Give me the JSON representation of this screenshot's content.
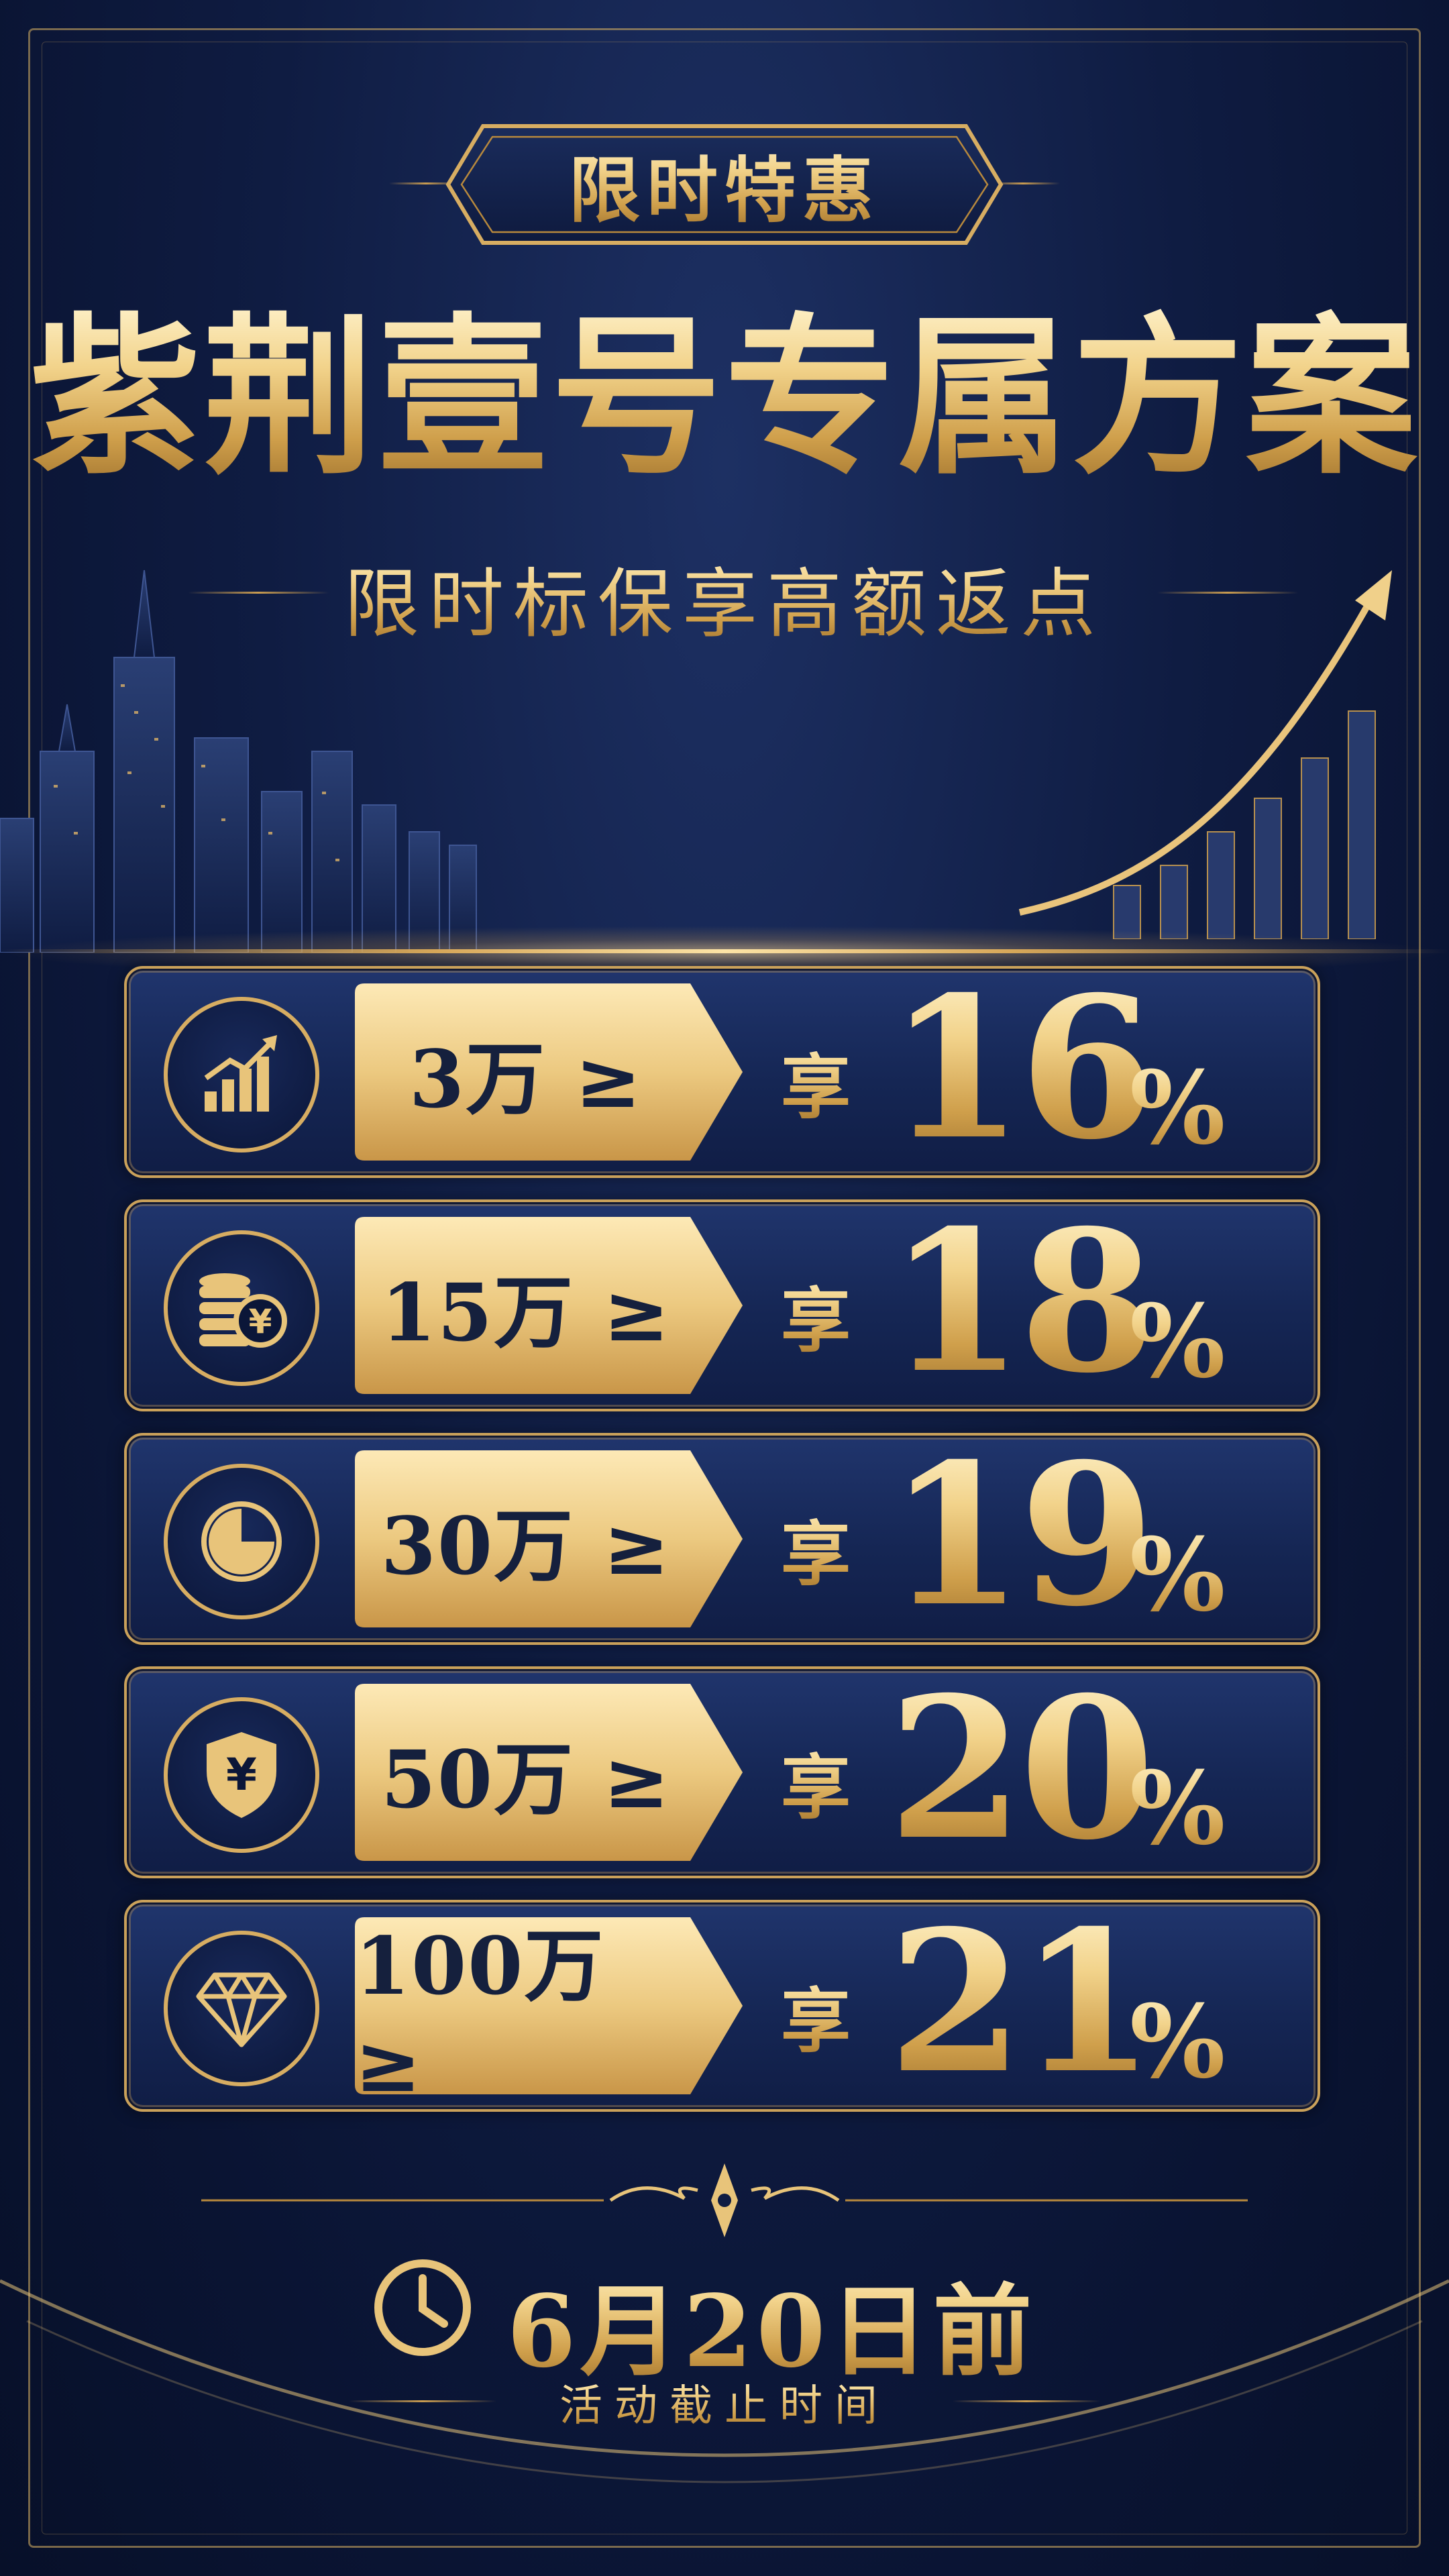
{
  "badge": {
    "label": "限时特惠"
  },
  "title": "紫荆壹号专属方案",
  "subtitle": "限时标保享高额返点",
  "tiers": [
    {
      "icon": "bar-chart-icon",
      "threshold": "3万 ≥",
      "enjoy": "享",
      "rate": "16",
      "pct": "%"
    },
    {
      "icon": "coins-yuan-icon",
      "threshold": "15万 ≥",
      "enjoy": "享",
      "rate": "18",
      "pct": "%"
    },
    {
      "icon": "pie-chart-icon",
      "threshold": "30万 ≥",
      "enjoy": "享",
      "rate": "19",
      "pct": "%"
    },
    {
      "icon": "shield-yuan-icon",
      "threshold": "50万 ≥",
      "enjoy": "享",
      "rate": "20",
      "pct": "%"
    },
    {
      "icon": "diamond-icon",
      "threshold": "100万 ≥",
      "enjoy": "享",
      "rate": "21",
      "pct": "%"
    }
  ],
  "footer": {
    "deadline": "6月20日前",
    "deadline_label": "活动截止时间"
  },
  "colors": {
    "background": "#0f1c42",
    "gold": "#e8c47a",
    "gold_dark": "#b8893d",
    "plate_text": "#15203d"
  }
}
